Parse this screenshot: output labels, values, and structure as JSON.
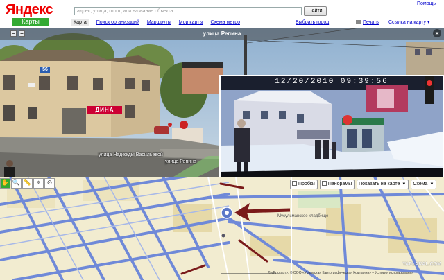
{
  "header": {
    "logo": "Яндекс",
    "logo_sub": "Карты",
    "search_placeholder": "адрес, улица, город или название объекта",
    "search_button": "Найти",
    "help_link": "Помощь",
    "nav": [
      "Карта",
      "Поиск организаций",
      "Маршруты",
      "Мои карты",
      "Схема метро"
    ],
    "city_link": "Выбрать город",
    "print_link": "Печать",
    "map_link": "Ссылка на карту ▾"
  },
  "panorama": {
    "title": "улица Репина",
    "zoom_out": "–",
    "zoom_in": "+",
    "close": "×",
    "house_number": "56",
    "shop_sign": "ДИНА",
    "street_labels": [
      "улица Надежды Васильевой",
      "улица Репина"
    ]
  },
  "inset": {
    "timestamp": "12/20/2010  09:39:56"
  },
  "map": {
    "tools": [
      "✋",
      "🔍",
      "📏",
      "⌖",
      "⊙"
    ],
    "layers": {
      "traffic": "Пробки",
      "panoramas": "Панорамы",
      "show_on_map": "Показать на карте",
      "scheme": "Схема"
    },
    "cemetery_label": "Мусульманское кладбище",
    "copyright": "© «Роскарт», © ООО «Уральская Картографическая Компания» – Условия использования",
    "watermark": "YAPLAKAL.COM"
  },
  "colors": {
    "road": "#6f89d8",
    "arrow": "#7a1a1a",
    "map_bg": "#f2ecd0",
    "block": "#ece3bd"
  }
}
